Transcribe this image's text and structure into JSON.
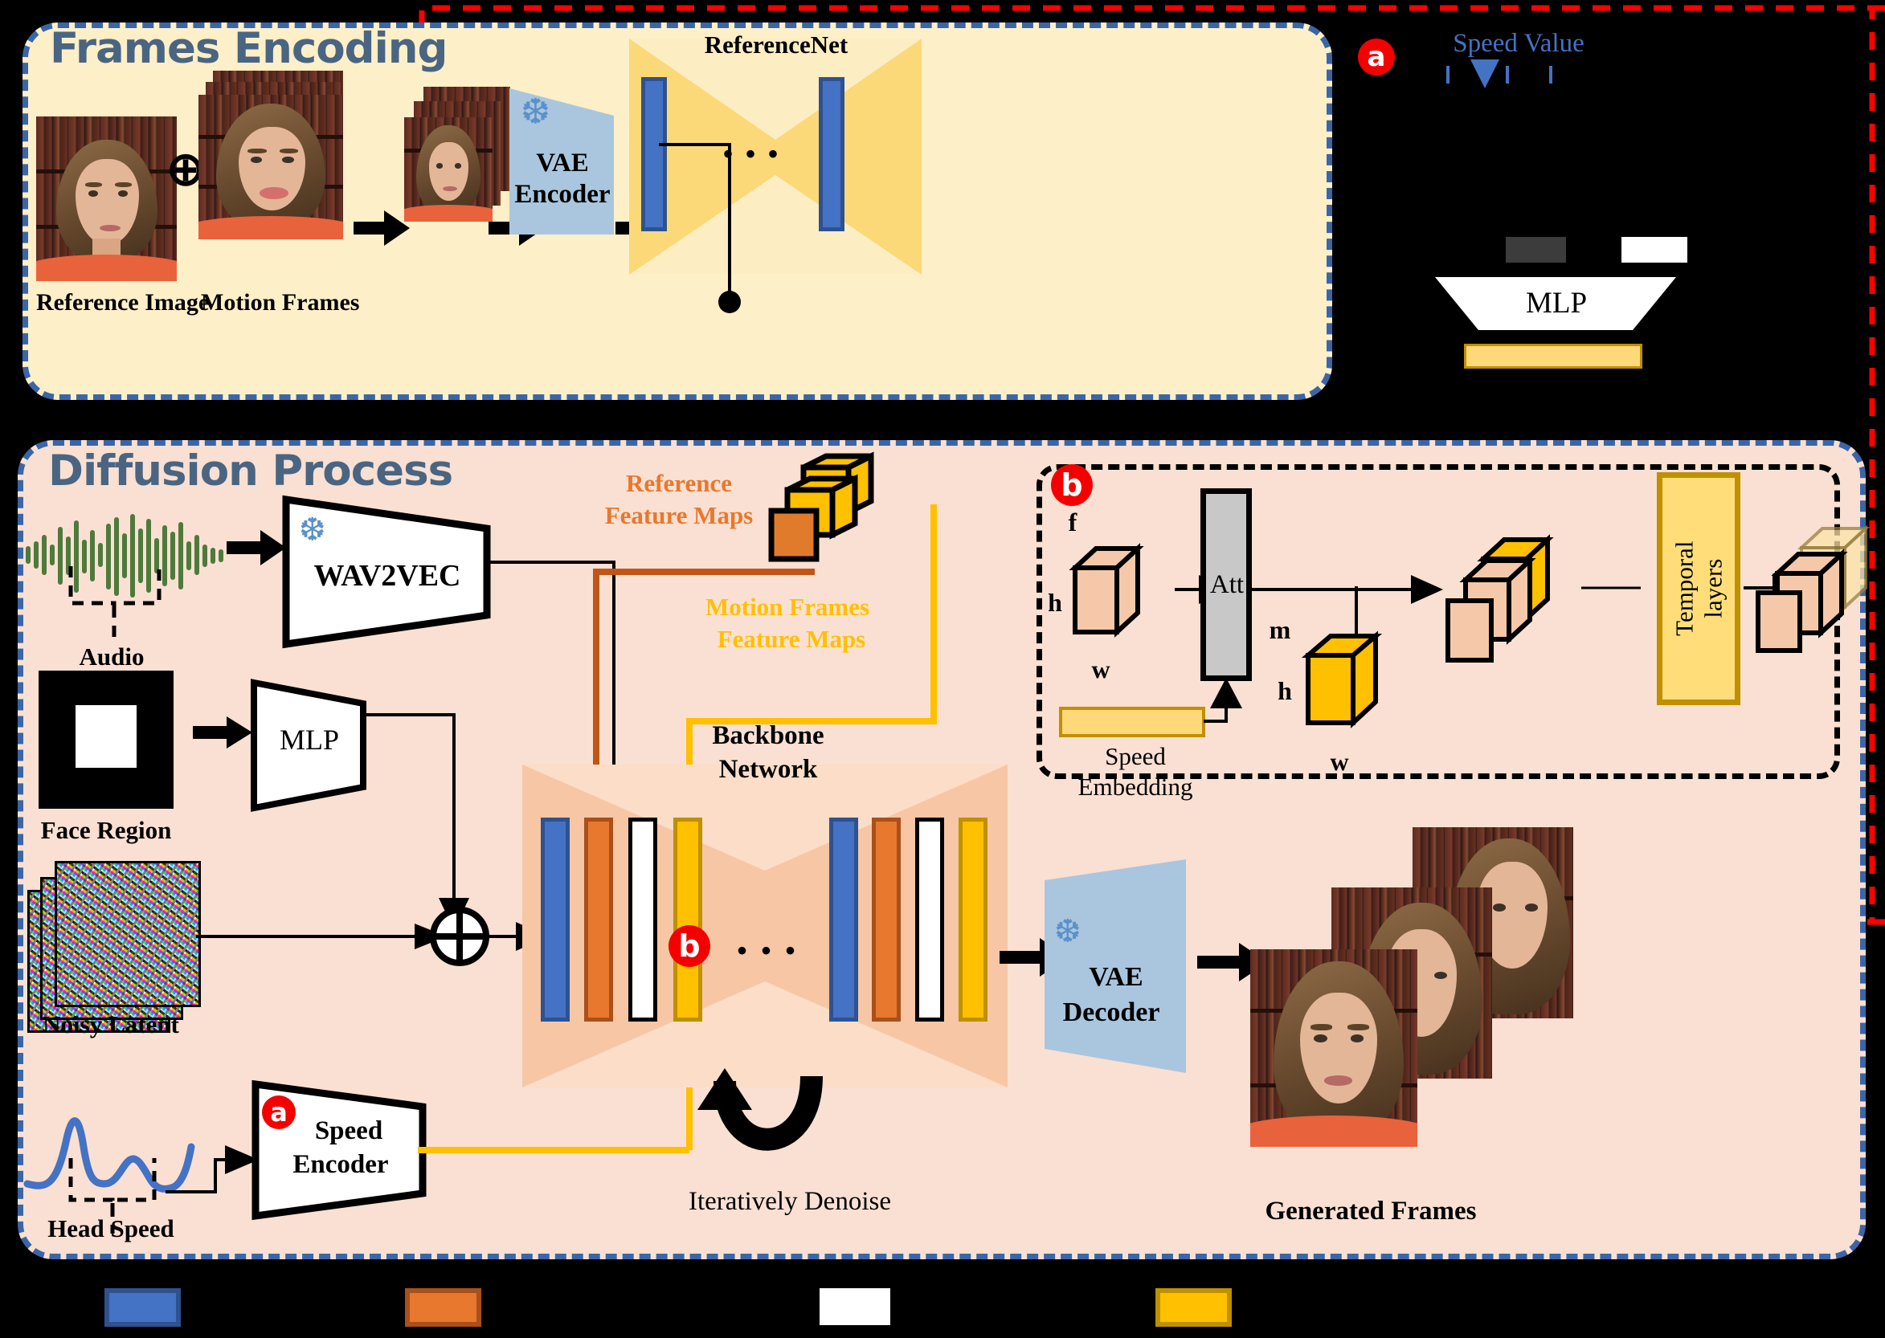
{
  "panels": {
    "frames": {
      "title": "Frames Encoding"
    },
    "diffusion": {
      "title": "Diffusion Process"
    }
  },
  "frames_encoding": {
    "reference_image_label": "Reference Image",
    "motion_frames_label": "Motion Frames",
    "plus_symbol": "⊕",
    "vae_encoder_label_line1": "VAE",
    "vae_encoder_label_line2": "Encoder",
    "referencenet_label": "ReferenceNet",
    "ellipsis": "• • •",
    "snowflake_icon": "❆"
  },
  "speed_legend": {
    "badge": "a",
    "title": "Speed Value",
    "mlp_label": "MLP"
  },
  "diffusion": {
    "audio_label": "Audio",
    "wav2vec_label": "WAV2VEC",
    "face_region_label": "Face Region",
    "mlp_label": "MLP",
    "noisy_latent_label": "Noisy Latent",
    "head_speed_label": "Head Speed",
    "speed_encoder_badge": "a",
    "speed_encoder_line1": "Speed",
    "speed_encoder_line2": "Encoder",
    "reference_feature_maps_line1": "Reference",
    "reference_feature_maps_line2": "Feature Maps",
    "motion_feature_maps_line1": "Motion Frames",
    "motion_feature_maps_line2": "Feature Maps",
    "backbone_line1": "Backbone",
    "backbone_line2": "Network",
    "backbone_badge": "b",
    "backbone_ellipsis": "• • •",
    "iteratively_denoise_label": "Iteratively Denoise",
    "vae_decoder_line1": "VAE",
    "vae_decoder_line2": "Decoder",
    "generated_frames_label": "Generated Frames",
    "plus_symbol": "⊕",
    "snowflake_icon": "❆"
  },
  "detail_b": {
    "badge": "b",
    "dim_f": "f",
    "dim_h_left": "h",
    "dim_w_left": "w",
    "att_label": "Att",
    "speed_embedding_line1": "Speed",
    "speed_embedding_line2": "Embedding",
    "dim_m": "m",
    "dim_h_mid": "h",
    "dim_w_mid": "w",
    "temporal_layers_line1": "Temporal",
    "temporal_layers_line2": "layers"
  },
  "legend": {
    "swatches": [
      {
        "name": "blue",
        "color": "#4472C4",
        "border": "#2F528F"
      },
      {
        "name": "orange",
        "color": "#E8782D",
        "border": "#A9501B"
      },
      {
        "name": "white",
        "color": "#FFFFFF",
        "border": "#FFFFFF"
      },
      {
        "name": "yellow",
        "color": "#FFC000",
        "border": "#BF9000"
      }
    ]
  },
  "colors": {
    "frames_panel_bg": "#FDEFC8",
    "diffusion_panel_bg": "#FAE0D2",
    "panel_border": "#3A66A8",
    "panel_title": "#4A6582",
    "referencenet_fill": "#FBD978",
    "referencenet_fill_light": "#FDEDC3",
    "backbone_fill": "#F7C6A5",
    "backbone_fill_light": "#FBDDC8",
    "vae_fill": "#A9C6DE",
    "blue_bar": "#4472C4",
    "blue_bar_border": "#2F528F",
    "orange_bar": "#E8782D",
    "orange_bar_border": "#A9501B",
    "yellow_bar": "#FFC000",
    "yellow_bar_border": "#BF9000",
    "ref_arrow": "#C05517",
    "motion_arrow": "#FFC000",
    "speed_arrow": "#FFC000",
    "badge_red": "#F50000",
    "speed_value_blue": "#4472C4",
    "audio_wave_green": "#4E7A3C",
    "head_speed_blue": "#4472C4",
    "att_gray": "#C8C8C8",
    "temporal_fill": "#FFDE7A",
    "temporal_border": "#BF9000",
    "cube_peach": "#F4C8A8",
    "cube_yellow": "#FFC000",
    "red_dashed": "#FF0000"
  }
}
